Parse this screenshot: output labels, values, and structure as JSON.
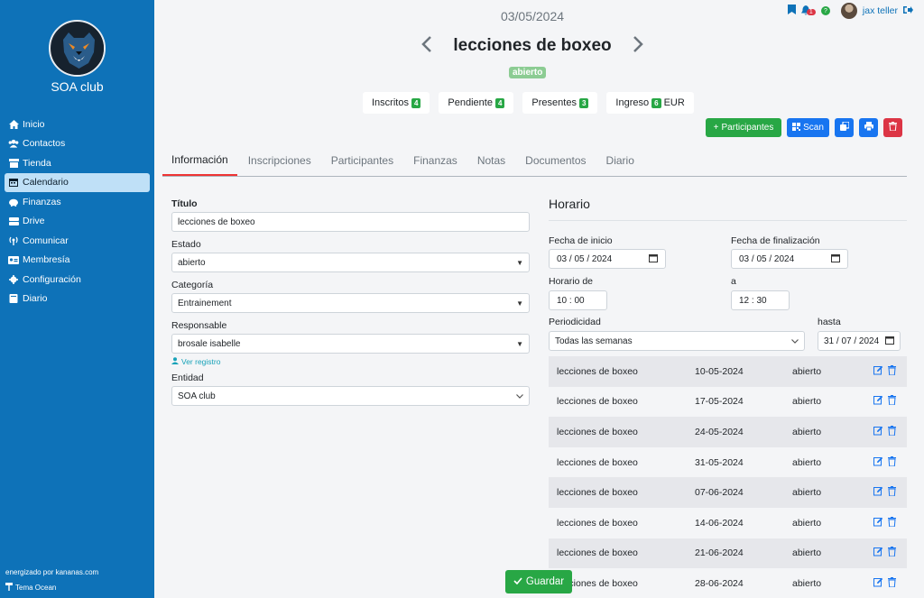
{
  "sidebar": {
    "club_name": "SOA club",
    "items": [
      {
        "label": "Inicio",
        "icon": "home-icon"
      },
      {
        "label": "Contactos",
        "icon": "users-icon"
      },
      {
        "label": "Tienda",
        "icon": "store-icon"
      },
      {
        "label": "Calendario",
        "icon": "calendar-icon",
        "active": true
      },
      {
        "label": "Finanzas",
        "icon": "piggy-bank-icon"
      },
      {
        "label": "Drive",
        "icon": "drive-icon"
      },
      {
        "label": "Comunicar",
        "icon": "broadcast-icon"
      },
      {
        "label": "Membresía",
        "icon": "id-card-icon"
      },
      {
        "label": "Configuración",
        "icon": "gear-icon"
      },
      {
        "label": "Diario",
        "icon": "book-icon"
      }
    ],
    "footer_powered": "energizado por kananas.com",
    "footer_theme": "Tema Ocean"
  },
  "topbar": {
    "notifications": "1",
    "help": "?",
    "user": "jax teller"
  },
  "header": {
    "date": "03/05/2024",
    "title": "lecciones de boxeo",
    "status": "abierto"
  },
  "counters": [
    {
      "label": "Inscritos",
      "value": "4"
    },
    {
      "label": "Pendiente",
      "value": "4"
    },
    {
      "label": "Presentes",
      "value": "3"
    },
    {
      "label": "Ingreso",
      "value": "6",
      "suffix": "EUR"
    }
  ],
  "actions": {
    "participants": "Participantes",
    "scan": "Scan"
  },
  "tabs": [
    "Información",
    "Inscripciones",
    "Participantes",
    "Finanzas",
    "Notas",
    "Documentos",
    "Diario"
  ],
  "form": {
    "title_label": "Título",
    "title_value": "lecciones de boxeo",
    "state_label": "Estado",
    "state_value": "abierto",
    "category_label": "Categoría",
    "category_value": "Entrainement",
    "owner_label": "Responsable",
    "owner_value": "brosale isabelle",
    "view_record": "Ver registro",
    "entity_label": "Entidad",
    "entity_value": "SOA club"
  },
  "schedule": {
    "title": "Horario",
    "start_label": "Fecha de inicio",
    "start_value": "03 / 05 / 2024",
    "end_label": "Fecha de finalización",
    "end_value": "03 / 05 / 2024",
    "from_label": "Horario de",
    "from_value": "10 : 00",
    "to_label": "a",
    "to_value": "12 : 30",
    "period_label": "Periodicidad",
    "period_value": "Todas las semanas",
    "until_label": "hasta",
    "until_value": "31 / 07 / 2024"
  },
  "occurrences": [
    {
      "name": "lecciones de boxeo",
      "date": "10-05-2024",
      "status": "abierto"
    },
    {
      "name": "lecciones de boxeo",
      "date": "17-05-2024",
      "status": "abierto"
    },
    {
      "name": "lecciones de boxeo",
      "date": "24-05-2024",
      "status": "abierto"
    },
    {
      "name": "lecciones de boxeo",
      "date": "31-05-2024",
      "status": "abierto"
    },
    {
      "name": "lecciones de boxeo",
      "date": "07-06-2024",
      "status": "abierto"
    },
    {
      "name": "lecciones de boxeo",
      "date": "14-06-2024",
      "status": "abierto"
    },
    {
      "name": "lecciones de boxeo",
      "date": "21-06-2024",
      "status": "abierto"
    },
    {
      "name": "lecciones de boxeo",
      "date": "28-06-2024",
      "status": "abierto"
    }
  ],
  "save_label": "Guardar"
}
